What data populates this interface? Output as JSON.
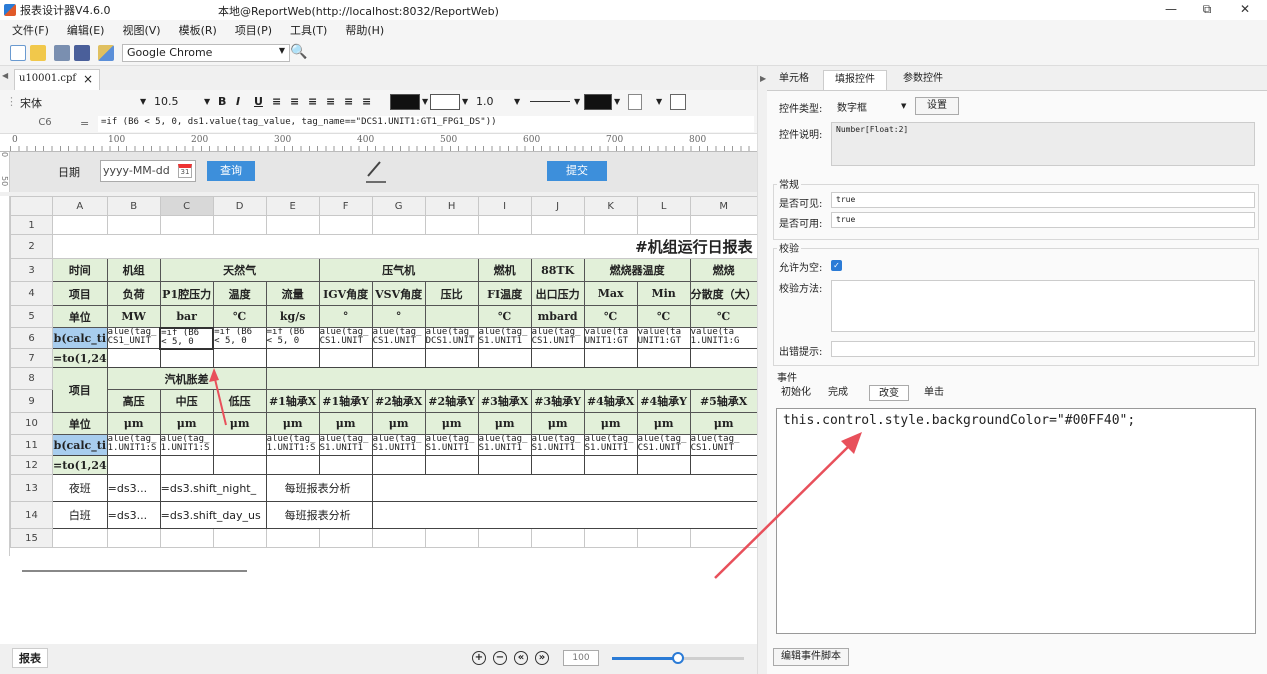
{
  "window": {
    "app_title": "报表设计器V4.6.0",
    "title": "本地@ReportWeb(http://localhost:8032/ReportWeb)",
    "minimize": "—",
    "restore": "⧉",
    "close": "✕"
  },
  "menu": [
    "文件(F)",
    "编辑(E)",
    "视图(V)",
    "模板(R)",
    "项目(P)",
    "工具(T)",
    "帮助(H)"
  ],
  "toolbar": {
    "browser": "Google Chrome"
  },
  "doc_tab": {
    "name": "u10001.cpf",
    "close": "×"
  },
  "format": {
    "font": "宋体",
    "size": "10.5",
    "bold": "B",
    "italic": "I",
    "underline": "U",
    "line_width": "1.0"
  },
  "formula": {
    "cell": "C6",
    "eq": "=",
    "text": "=if (B6 < 5, 0, ds1.value(tag_value, tag_name==\"DCS1.UNIT1:GT1_FPG1_DS\"))"
  },
  "ruler": [
    "0",
    "100",
    "200",
    "300",
    "400",
    "500",
    "600",
    "700",
    "800"
  ],
  "vruler": [
    "0",
    "50"
  ],
  "params": {
    "date_label": "日期",
    "date_placeholder": "yyyy-MM-dd",
    "cal_num": "31",
    "query_btn": "查询",
    "submit_btn": "提交"
  },
  "grid": {
    "cols": [
      "A",
      "B",
      "C",
      "D",
      "E",
      "F",
      "G",
      "H",
      "I",
      "J",
      "K",
      "L",
      "M"
    ],
    "row_nums": [
      "1",
      "2",
      "3",
      "4",
      "5",
      "6",
      "7",
      "8",
      "9",
      "10",
      "11",
      "12",
      "13",
      "14",
      "15"
    ],
    "title": "#机组运行日报表",
    "r3": [
      "时间",
      "机组",
      "天然气",
      "压气机",
      "燃机",
      "88TK",
      "燃烧器温度",
      "燃烧"
    ],
    "r4": [
      "项目",
      "负荷",
      "P1腔压力",
      "温度",
      "流量",
      "IGV角度",
      "VSV角度",
      "压比",
      "FI温度",
      "出口压力",
      "Max",
      "Min",
      "分散度（大）"
    ],
    "r5": [
      "单位",
      "MW",
      "bar",
      "℃",
      "kg/s",
      "°",
      "°",
      "",
      "℃",
      "mbard",
      "℃",
      "℃",
      "℃"
    ],
    "r6": [
      "b(calc_ti",
      "alue(tag_\nCS1_UNIT",
      "=if (B6\n< 5, 0",
      "=if (B6\n< 5, 0",
      "=if (B6\n< 5, 0",
      "alue(tag_\nCS1.UNIT",
      "alue(tag_\nCS1.UNIT",
      "alue(tag_\nDCS1.UNIT",
      "alue(tag_\nS1.UNIT1",
      "alue(tag_\nCS1.UNIT",
      "value(ta\nUNIT1:GT",
      "value(ta\nUNIT1:GT",
      "value(ta\n1.UNIT1:G"
    ],
    "r7": "=to(1,24",
    "r8": [
      "项目",
      "汽机胀差"
    ],
    "r9": [
      "高压",
      "中压",
      "低压",
      "#1轴承X",
      "#1轴承Y",
      "#2轴承X",
      "#2轴承Y",
      "#3轴承X",
      "#3轴承Y",
      "#4轴承X",
      "#4轴承Y",
      "#5轴承X"
    ],
    "r10": [
      "单位",
      "μm",
      "μm",
      "μm",
      "μm",
      "μm",
      "μm",
      "μm",
      "μm",
      "μm",
      "μm",
      "μm",
      "μm"
    ],
    "r11": [
      "b(calc_ti",
      "alue(tag_\n1.UNIT1:S",
      "alue(tag_\n1.UNIT1:S",
      "",
      "alue(tag_\n1.UNIT1:S",
      "alue(tag_\nS1.UNIT1",
      "alue(tag_\nS1.UNIT1",
      "alue(tag_\nS1.UNIT1",
      "alue(tag_\nS1.UNIT1",
      "alue(tag_\nS1.UNIT1",
      "alue(tag_\nS1.UNIT1",
      "alue(tag_\nCS1.UNIT",
      "alue(tag_\nCS1.UNIT"
    ],
    "r12": "=to(1,24",
    "r13": [
      "夜班",
      "=ds3...",
      "=ds3.shift_night_",
      "每班报表分析"
    ],
    "r14": [
      "白班",
      "=ds3...",
      "=ds3.shift_day_us",
      "每班报表分析"
    ]
  },
  "bottom": {
    "sheet_tab": "报表",
    "zoom_in": "+",
    "zoom_out": "−",
    "first": "«",
    "last": "»",
    "zoom": "100",
    "zoom_level": 0.5
  },
  "panel": {
    "tabs": [
      "单元格",
      "填报控件",
      "参数控件"
    ],
    "control_type_label": "控件类型:",
    "control_type": "数字框",
    "settings_btn": "设置",
    "desc_label": "控件说明:",
    "desc": "Number[Float:2]",
    "general_title": "常规",
    "visible_label": "是否可见:",
    "visible": "true",
    "enabled_label": "是否可用:",
    "enabled": "true",
    "validate_title": "校验",
    "allow_empty_label": "允许为空:",
    "method_label": "校验方法:",
    "error_label": "出错提示:",
    "events_title": "事件",
    "event_tabs": [
      "初始化",
      "完成",
      "改变",
      "单击"
    ],
    "script": "this.control.style.backgroundColor=\"#00FF40\";",
    "edit_script_btn": "编辑事件脚本"
  },
  "colors": {
    "accent": "#3d8fdb",
    "green_cell": "#e2f0d9",
    "arrow": "#e8505b"
  }
}
